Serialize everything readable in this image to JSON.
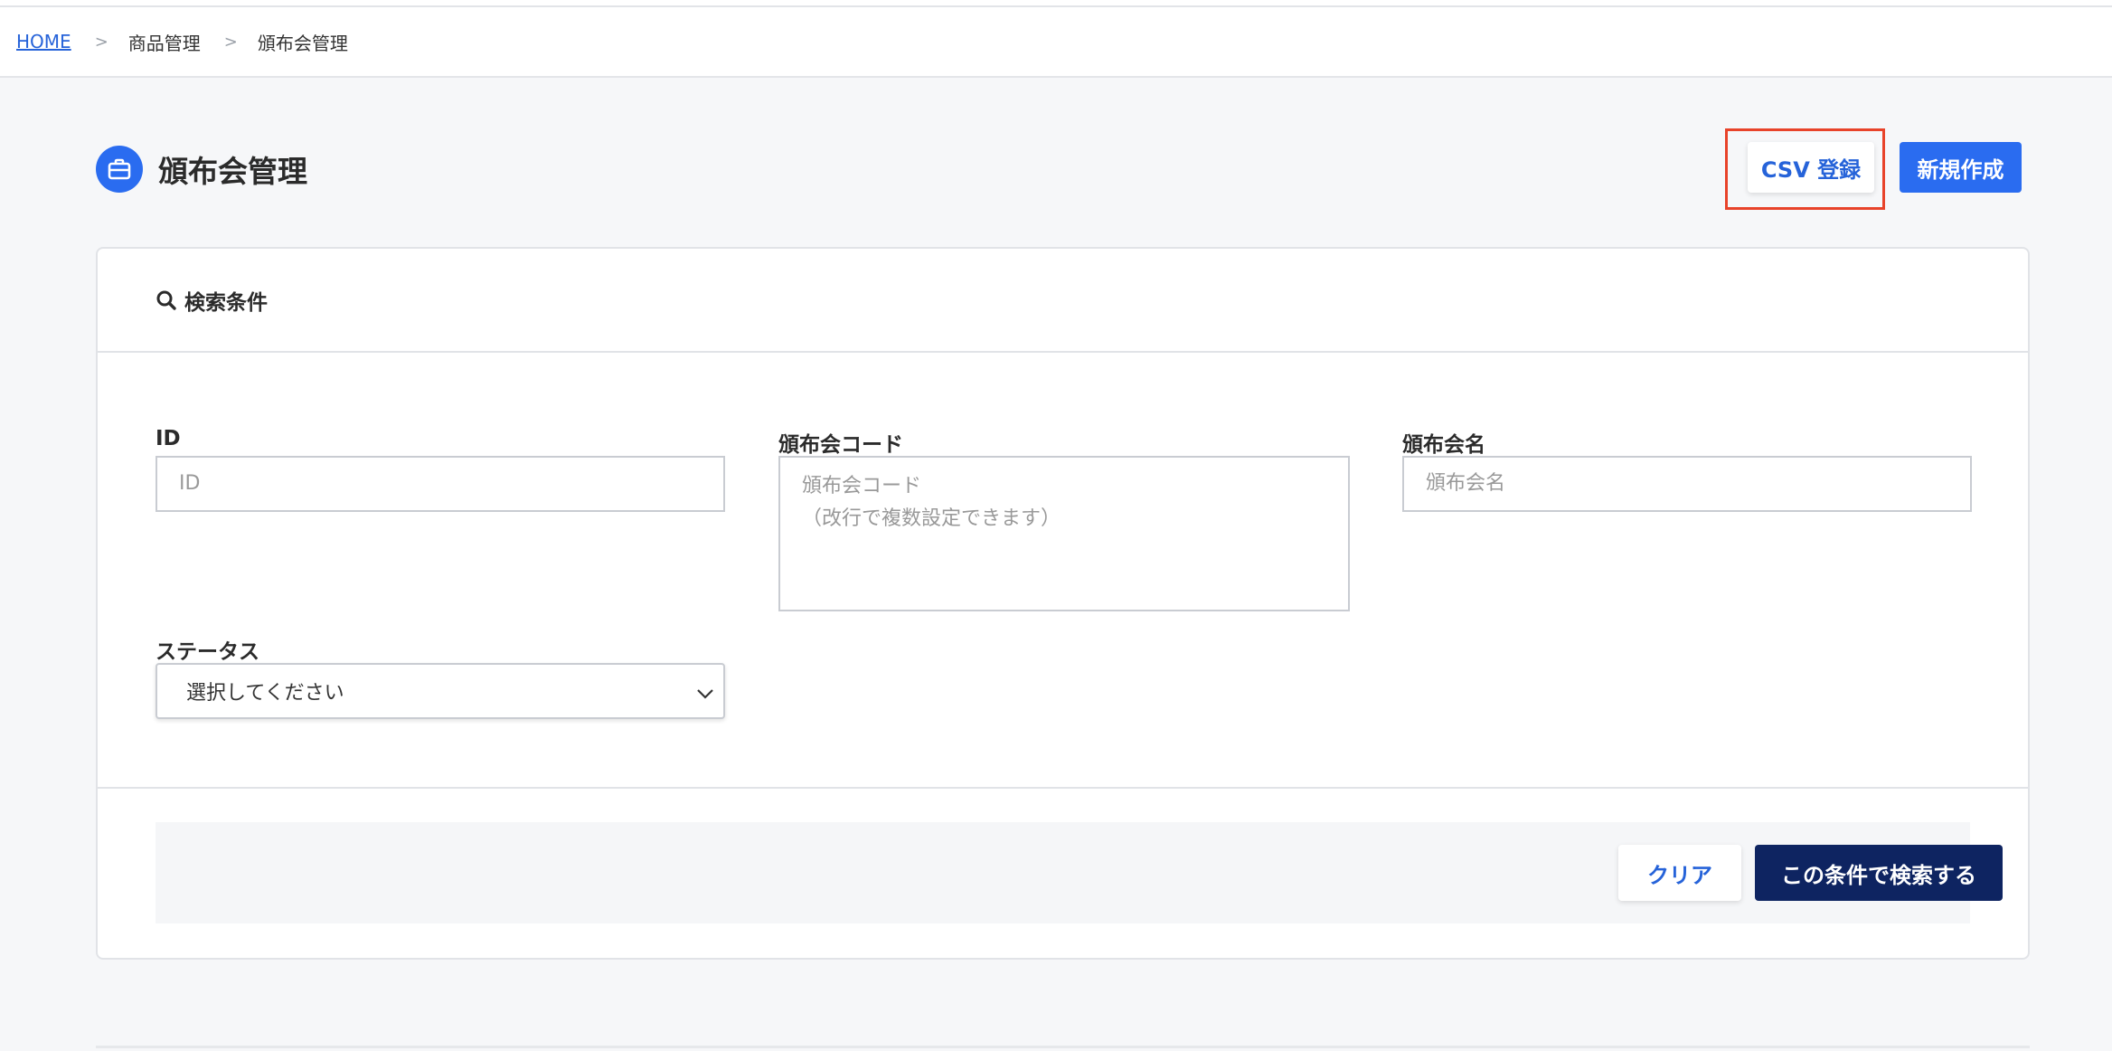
{
  "breadcrumb": {
    "home": "HOME",
    "separator": ">",
    "level1": "商品管理",
    "level2": "頒布会管理"
  },
  "header": {
    "title": "頒布会管理",
    "icon": "briefcase-icon",
    "csv_button": "CSV 登録",
    "new_button": "新規作成"
  },
  "search": {
    "heading": "検索条件",
    "fields": {
      "id": {
        "label": "ID",
        "placeholder": "ID",
        "value": ""
      },
      "code": {
        "label": "頒布会コード",
        "placeholder": "頒布会コード\n（改行で複数設定できます）",
        "value": ""
      },
      "name": {
        "label": "頒布会名",
        "placeholder": "頒布会名",
        "value": ""
      },
      "status": {
        "label": "ステータス",
        "selected": "選択してください"
      }
    },
    "clear_button": "クリア",
    "search_button": "この条件で検索する"
  },
  "colors": {
    "primary": "#2a6cf0",
    "navy": "#0e2461",
    "highlight": "#e8432a"
  }
}
